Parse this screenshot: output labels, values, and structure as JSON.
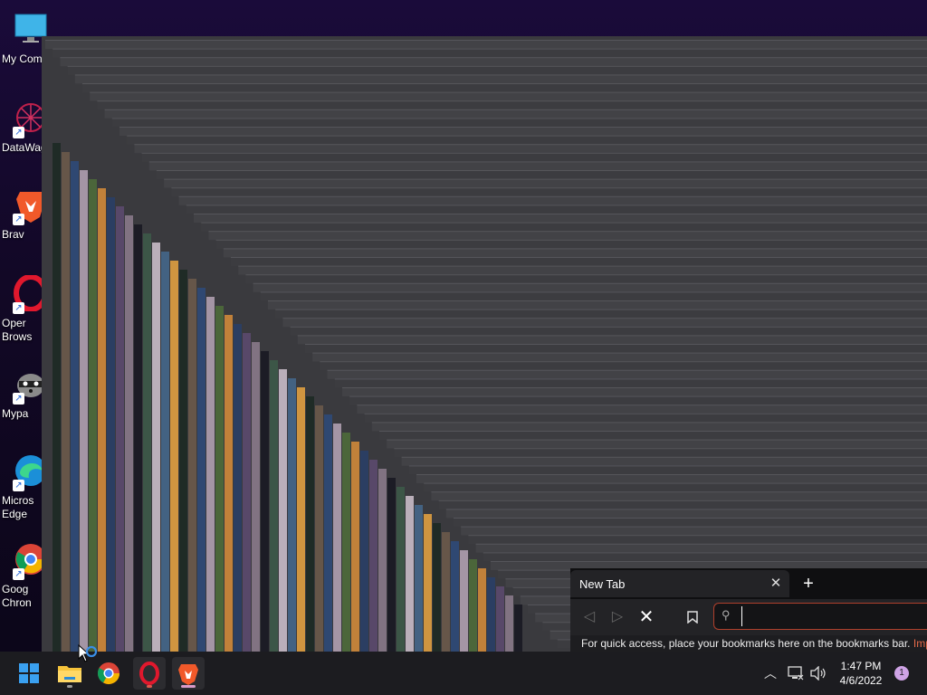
{
  "desktop": {
    "icons": [
      {
        "label": "My Com",
        "icon": "monitor-icon"
      },
      {
        "label": "DataWag",
        "icon": "datawag-icon"
      },
      {
        "label": "Brav",
        "icon": "brave-icon"
      },
      {
        "label": "Oper",
        "label2": "Brows",
        "icon": "opera-icon"
      },
      {
        "label": "Mypa",
        "icon": "raccoon-icon"
      },
      {
        "label": "Micros",
        "label2": "Edge",
        "icon": "edge-icon"
      },
      {
        "label": "Goog",
        "label2": "Chron",
        "icon": "chrome-icon"
      }
    ]
  },
  "browser": {
    "tab_title": "New Tab",
    "tab_close": "✕",
    "new_tab": "+",
    "address_value": "",
    "bookmarks_hint": "For quick access, place your bookmarks here on the bookmarks bar.",
    "bookmarks_link": "Imp",
    "accent": "#b0402c"
  },
  "taskbar": {
    "apps": [
      "start-icon",
      "file-explorer-icon",
      "chrome-icon",
      "opera-icon",
      "brave-icon"
    ],
    "time": "1:47 PM",
    "date": "4/6/2022",
    "notifications": "1"
  }
}
